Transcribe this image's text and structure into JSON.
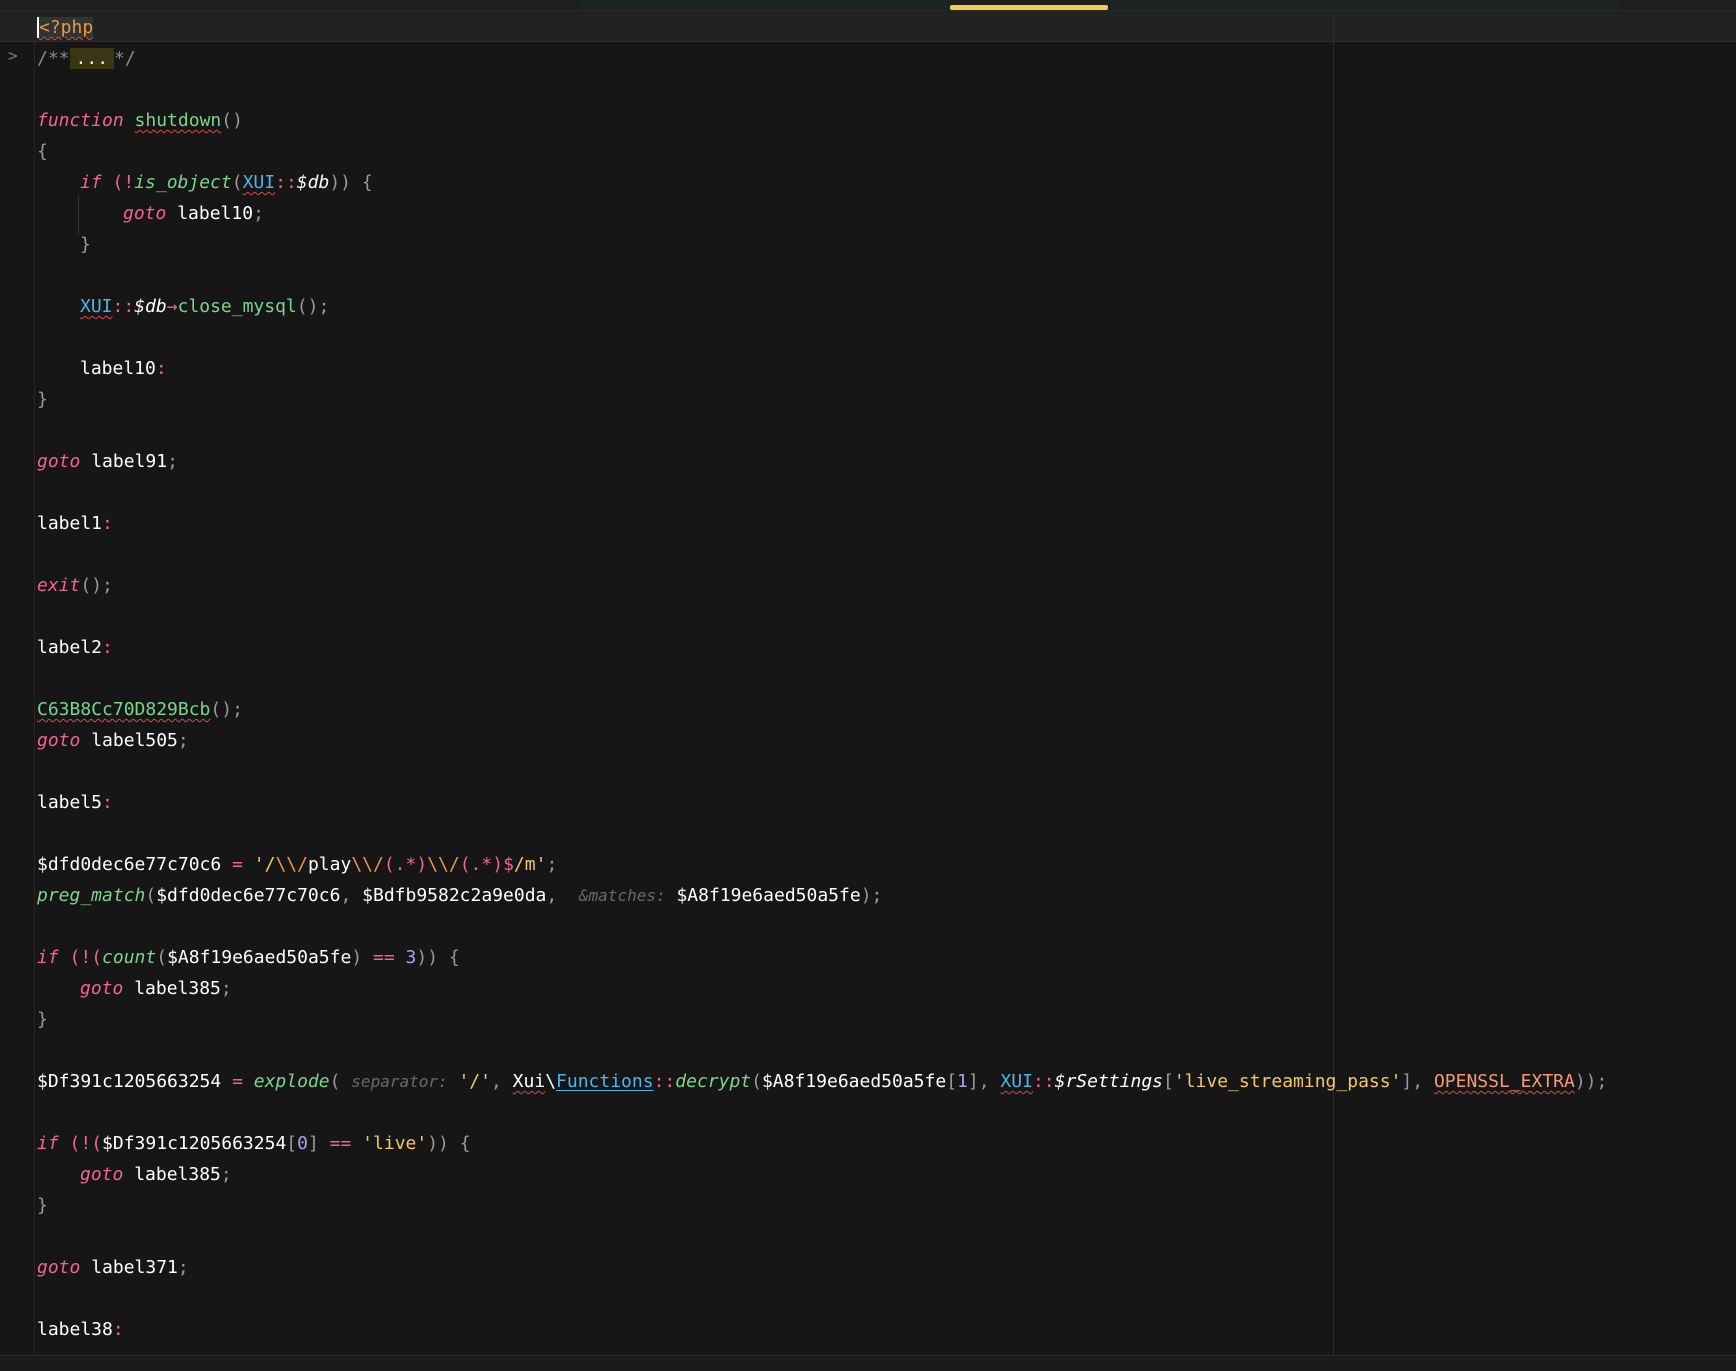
{
  "editor": {
    "language": "php",
    "fold_marker": ">",
    "lines": {
      "l1": "<?php",
      "l2_open": "/**",
      "l2_fold": "...",
      "l2_close": "*/",
      "l4_kw": "function",
      "l4_name": "shutdown",
      "l4_paren": "()",
      "l5": "{",
      "l6_kw": "if",
      "l6_a": " (!",
      "l6_fn": "is_object",
      "l6_b": "(",
      "l6_cls": "XUI",
      "l6_sep": "::",
      "l6_var": "$db",
      "l6_c": ")) {",
      "l7_kw": "goto",
      "l7_label": " label10",
      "l7_semi": ";",
      "l8": "}",
      "l10_cls": "XUI",
      "l10_sep": "::",
      "l10_var": "$db",
      "l10_arrow": "→",
      "l10_method": "close_mysql",
      "l10_tail": "();",
      "l12_label": "label10",
      "l12_colon": ":",
      "l13": "}",
      "l15_kw": "goto",
      "l15_label": " label91",
      "l15_semi": ";",
      "l17_label": "label1",
      "l17_colon": ":",
      "l19_kw": "exit",
      "l19_tail": "();",
      "l21_label": "label2",
      "l21_colon": ":",
      "l23_fn": "C63B8Cc70D829Bcb",
      "l23_tail": "();",
      "l24_kw": "goto",
      "l24_label": " label505",
      "l24_semi": ";",
      "l26_label": "label5",
      "l26_colon": ":",
      "l28_var": "$dfd0dec6e77c70c6",
      "l28_eq": " = ",
      "l28_q1": "'",
      "l28_s1": "/",
      "l28_e1": "\\\\/",
      "l28_s2": "play",
      "l28_e2": "\\\\/",
      "l28_g1": "(.*)",
      "l28_e3": "\\\\/",
      "l28_g2": "(.*)",
      "l28_end": "$",
      "l28_s3": "/m",
      "l28_q2": "'",
      "l28_semi": ";",
      "l29_fn": "preg_match",
      "l29_a": "(",
      "l29_v1": "$dfd0dec6e77c70c6",
      "l29_c1": ", ",
      "l29_v2": "$Bdfb9582c2a9e0da",
      "l29_c2": ", ",
      "l29_hint": "&matches:",
      "l29_v3": " $A8f19e6aed50a5fe",
      "l29_tail": ");",
      "l31_kw": "if",
      "l31_a": " (!(",
      "l31_fn": "count",
      "l31_b": "(",
      "l31_v": "$A8f19e6aed50a5fe",
      "l31_c": ") ",
      "l31_op": "==",
      "l31_num": " 3",
      "l31_d": ")) {",
      "l32_kw": "goto",
      "l32_label": " label385",
      "l32_semi": ";",
      "l33": "}",
      "l35_var": "$Df391c1205663254",
      "l35_eq": " = ",
      "l35_fn": "explode",
      "l35_a": "( ",
      "l35_hint": "separator:",
      "l35_str1": " '/'",
      "l35_c1": ", ",
      "l35_ns": "Xui",
      "l35_bs": "\\",
      "l35_cls": "Functions",
      "l35_sep": "::",
      "l35_method": "decrypt",
      "l35_b": "(",
      "l35_v1": "$A8f19e6aed50a5fe",
      "l35_br1": "[",
      "l35_num": "1",
      "l35_br2": "]",
      "l35_c2": ", ",
      "l35_cls2": "XUI",
      "l35_sep2": "::",
      "l35_var2": "$rSettings",
      "l35_br3": "[",
      "l35_str2": "'live_streaming_pass'",
      "l35_br4": "]",
      "l35_c3": ", ",
      "l35_const": "OPENSSL_EXTRA",
      "l35_tail": "));",
      "l37_kw": "if",
      "l37_a": " (!(",
      "l37_v": "$Df391c1205663254",
      "l37_br1": "[",
      "l37_num": "0",
      "l37_br2": "] ",
      "l37_op": "==",
      "l37_str": " 'live'",
      "l37_d": ")) {",
      "l38_kw": "goto",
      "l38_label": " label385",
      "l38_semi": ";",
      "l39": "}",
      "l41_kw": "goto",
      "l41_label": " label371",
      "l41_semi": ";",
      "l43_label": "label38",
      "l43_colon": ":"
    }
  },
  "colors": {
    "background": "#161616",
    "keyword": "#f2648f",
    "function": "#7dd48c",
    "class": "#4fb3e8",
    "string": "#f5c869",
    "number": "#b39df3",
    "active_indicator": "#f0cf50"
  }
}
